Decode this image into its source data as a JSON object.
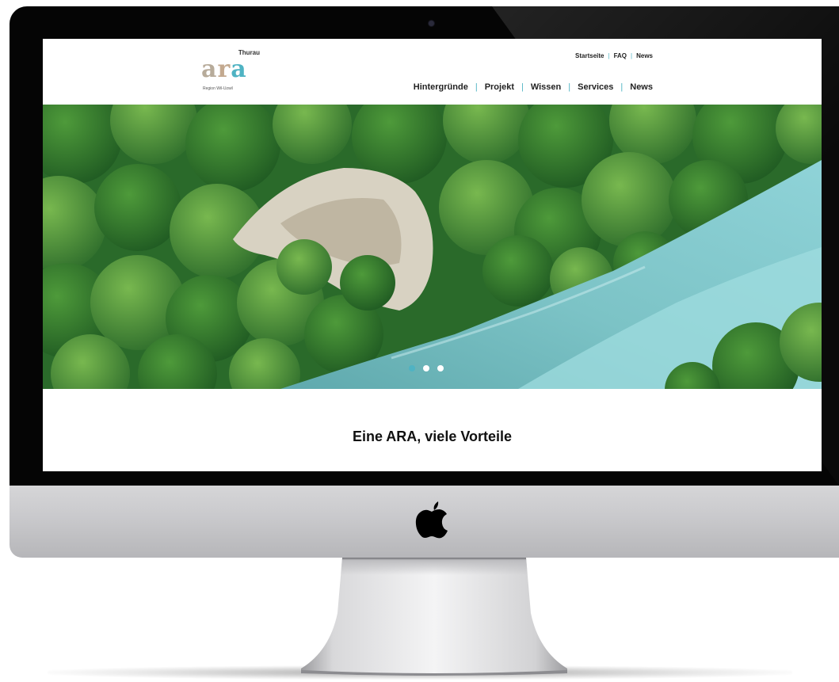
{
  "logo": {
    "top_label": "Thurau",
    "wordmark": [
      "a",
      "r",
      "a"
    ],
    "subtitle": "Region Wil-Uzwil"
  },
  "top_links": [
    "Startseite",
    "FAQ",
    "News"
  ],
  "main_nav": [
    "Hintergründe",
    "Projekt",
    "Wissen",
    "Services",
    "News"
  ],
  "separator": "|",
  "hero": {
    "image": "aerial-river-forest",
    "slider_dots": 3,
    "active_dot": 0
  },
  "section": {
    "title": "Eine ARA, viele Vorteile"
  },
  "colors": {
    "accent": "#4fb3c3",
    "logo_beige": "#b7ab9a",
    "text_dark": "#222222"
  }
}
